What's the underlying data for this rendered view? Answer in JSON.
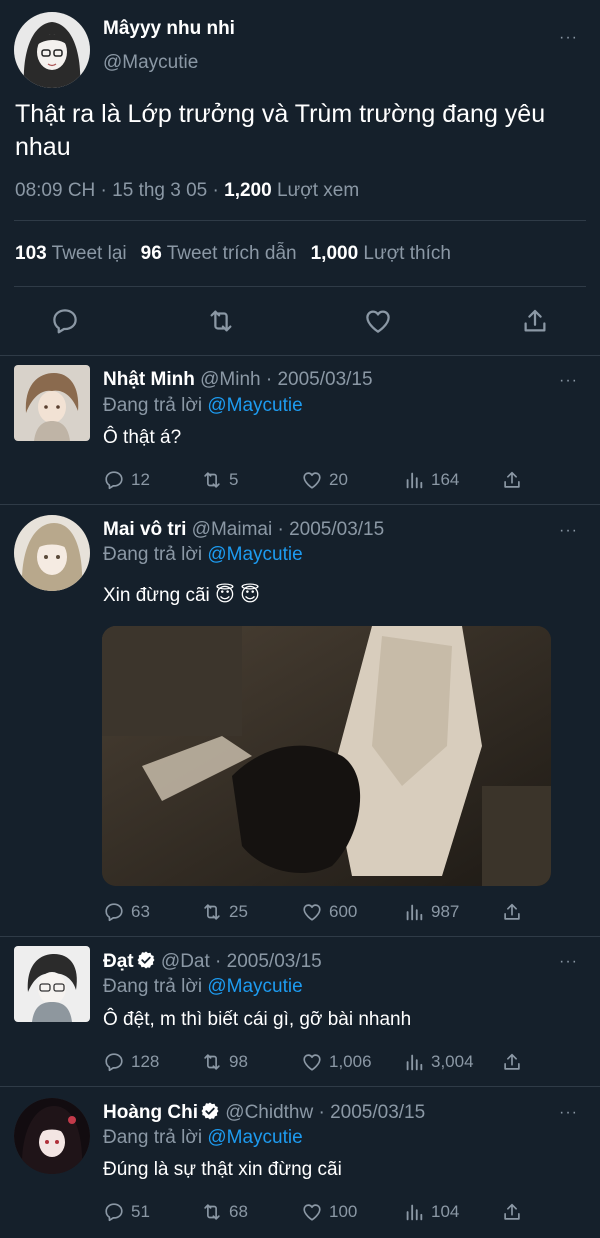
{
  "main": {
    "name": "Mâyyy nhu nhi",
    "handle": "@Maycutie",
    "text": "Thật ra là Lớp trưởng và Trùm trường đang yêu nhau",
    "time": "08:09 CH · 15 thg 3 05 · ",
    "views_count": "1,200",
    "views_label": " Lượt xem",
    "retweets_count": "103",
    "retweets_label": " Tweet lại",
    "quotes_count": "96",
    "quotes_label": " Tweet trích dẫn",
    "likes_count": "1,000",
    "likes_label": " Lượt thích"
  },
  "replies": [
    {
      "name": "Nhật Minh",
      "handle": " @Minh · 2005/03/15",
      "replying_prefix": "Đang trả lời ",
      "replying_to": "@Maycutie",
      "text": "Ô thật á?",
      "replies": "12",
      "retweets": "5",
      "likes": "20",
      "views": "164"
    },
    {
      "name": "Mai vô tri",
      "handle": " @Maimai · 2005/03/15",
      "replying_prefix": "Đang trả lời ",
      "replying_to": "@Maycutie",
      "text": "Xin đừng cãi 😇 😇",
      "replies": "63",
      "retweets": "25",
      "likes": "600",
      "views": "987"
    },
    {
      "name": "Đạt",
      "handle": " @Dat · 2005/03/15",
      "replying_prefix": "Đang trả lời ",
      "replying_to": "@Maycutie",
      "text": "Ô đệt, m thì biết cái gì, gỡ bài nhanh",
      "replies": "128",
      "retweets": "98",
      "likes": "1,006",
      "views": "3,004"
    },
    {
      "name": "Hoàng Chi",
      "handle": " @Chidthw · 2005/03/15",
      "replying_prefix": "Đang trả lời ",
      "replying_to": "@Maycutie",
      "text": "Đúng là sự thật xin đừng cãi",
      "replies": "51",
      "retweets": "68",
      "likes": "100",
      "views": "104"
    }
  ],
  "more_glyph": "···",
  "colors": {
    "background": "#15202b",
    "muted_text": "#8b98a5",
    "link": "#1d9bf0",
    "divider": "#2f3b47"
  },
  "icons": [
    "reply-icon",
    "retweet-icon",
    "like-icon",
    "share-icon",
    "views-icon",
    "more-icon",
    "verified-badge-icon"
  ]
}
